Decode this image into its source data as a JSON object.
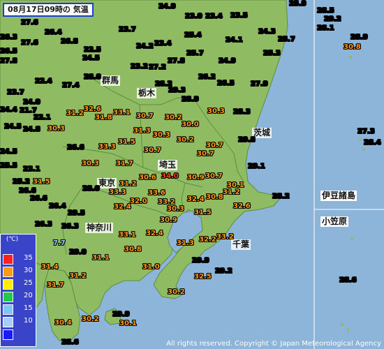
{
  "title": "08月17日09時の 気温",
  "copyright": "All rights reserved. Copyright © Japan Meteorological Agency",
  "colors": {
    "sea": "#8db4d9",
    "land": "#8fbb63",
    "border": "#5d8d3f",
    "legend_bg": "#3a44c8"
  },
  "legend": {
    "unit": "(℃)",
    "items": [
      {
        "value": "35",
        "color": "#ff2020"
      },
      {
        "value": "30",
        "color": "#ff9a16"
      },
      {
        "value": "25",
        "color": "#ffee00"
      },
      {
        "value": "20",
        "color": "#22c94a"
      },
      {
        "value": "15",
        "color": "#7fc4f4"
      },
      {
        "value": "10",
        "color": "#aacbff"
      },
      {
        "value": "",
        "color": "#1a1aff"
      }
    ]
  },
  "places": [
    {
      "name": "群馬",
      "id": "gunma"
    },
    {
      "name": "栃木",
      "id": "tochigi"
    },
    {
      "name": "茨城",
      "id": "ibaraki"
    },
    {
      "name": "埼玉",
      "id": "saitama"
    },
    {
      "name": "東京",
      "id": "tokyo"
    },
    {
      "name": "神奈川",
      "id": "kanagawa"
    },
    {
      "name": "千葉",
      "id": "chiba"
    },
    {
      "name": "伊豆諸島",
      "id": "izu"
    },
    {
      "name": "小笠原",
      "id": "ogasawara"
    }
  ],
  "stations": [
    {
      "v": "24.9",
      "c": "green"
    },
    {
      "v": "25.9",
      "c": "green"
    },
    {
      "v": "23.0",
      "c": "green"
    },
    {
      "v": "23.4",
      "c": "green"
    },
    {
      "v": "23.5",
      "c": "green"
    },
    {
      "v": "26.3",
      "c": "green"
    },
    {
      "v": "27.6",
      "c": "green"
    },
    {
      "v": "26.4",
      "c": "green"
    },
    {
      "v": "28.5",
      "c": "green"
    },
    {
      "v": "29.2",
      "c": "green"
    },
    {
      "v": "28.1",
      "c": "green"
    },
    {
      "v": "23.7",
      "c": "green"
    },
    {
      "v": "24.3",
      "c": "green"
    },
    {
      "v": "25.7",
      "c": "green"
    },
    {
      "v": "27.6",
      "c": "green"
    },
    {
      "v": "26.8",
      "c": "green"
    },
    {
      "v": "25.4",
      "c": "green"
    },
    {
      "v": "24.1",
      "c": "green"
    },
    {
      "v": "28.9",
      "c": "green"
    },
    {
      "v": "24.2",
      "c": "green"
    },
    {
      "v": "23.4",
      "c": "green"
    },
    {
      "v": "30.8",
      "c": "orange"
    },
    {
      "v": "26.5",
      "c": "green"
    },
    {
      "v": "22.5",
      "c": "green"
    },
    {
      "v": "25.7",
      "c": "green"
    },
    {
      "v": "25.3",
      "c": "green"
    },
    {
      "v": "27.8",
      "c": "green"
    },
    {
      "v": "24.5",
      "c": "green"
    },
    {
      "v": "27.8",
      "c": "green"
    },
    {
      "v": "24.9",
      "c": "green"
    },
    {
      "v": "23.2",
      "c": "green"
    },
    {
      "v": "27.2",
      "c": "green"
    },
    {
      "v": "28.0",
      "c": "green"
    },
    {
      "v": "26.2",
      "c": "green"
    },
    {
      "v": "22.4",
      "c": "green"
    },
    {
      "v": "27.4",
      "c": "green"
    },
    {
      "v": "28.2",
      "c": "green"
    },
    {
      "v": "26.5",
      "c": "green"
    },
    {
      "v": "27.9",
      "c": "green"
    },
    {
      "v": "23.7",
      "c": "green"
    },
    {
      "v": "29.3",
      "c": "green"
    },
    {
      "v": "24.0",
      "c": "green"
    },
    {
      "v": "28.9",
      "c": "green"
    },
    {
      "v": "24.4",
      "c": "green"
    },
    {
      "v": "21.7",
      "c": "green"
    },
    {
      "v": "32.6",
      "c": "orange"
    },
    {
      "v": "33.1",
      "c": "orange"
    },
    {
      "v": "30.3",
      "c": "orange"
    },
    {
      "v": "28.3",
      "c": "green"
    },
    {
      "v": "22.1",
      "c": "green"
    },
    {
      "v": "31.2",
      "c": "orange"
    },
    {
      "v": "31.8",
      "c": "orange"
    },
    {
      "v": "30.7",
      "c": "orange"
    },
    {
      "v": "30.2",
      "c": "orange"
    },
    {
      "v": "24.5",
      "c": "green"
    },
    {
      "v": "24.8",
      "c": "green"
    },
    {
      "v": "30.3",
      "c": "orange"
    },
    {
      "v": "31.3",
      "c": "orange"
    },
    {
      "v": "30.0",
      "c": "orange"
    },
    {
      "v": "27.3",
      "c": "green"
    },
    {
      "v": "30.3",
      "c": "orange"
    },
    {
      "v": "29.8",
      "c": "green"
    },
    {
      "v": "28.4",
      "c": "green"
    },
    {
      "v": "26.6",
      "c": "green"
    },
    {
      "v": "33.3",
      "c": "orange"
    },
    {
      "v": "31.5",
      "c": "orange"
    },
    {
      "v": "30.2",
      "c": "orange"
    },
    {
      "v": "30.7",
      "c": "orange"
    },
    {
      "v": "24.5",
      "c": "green"
    },
    {
      "v": "30.7",
      "c": "orange"
    },
    {
      "v": "30.7",
      "c": "orange"
    },
    {
      "v": "25.5",
      "c": "green"
    },
    {
      "v": "30.3",
      "c": "orange"
    },
    {
      "v": "31.7",
      "c": "orange"
    },
    {
      "v": "29.1",
      "c": "green"
    },
    {
      "v": "23.1",
      "c": "green"
    },
    {
      "v": "30.6",
      "c": "orange"
    },
    {
      "v": "34.0",
      "c": "red"
    },
    {
      "v": "30.9",
      "c": "orange"
    },
    {
      "v": "30.7",
      "c": "orange"
    },
    {
      "v": "25.2",
      "c": "green"
    },
    {
      "v": "31.5",
      "c": "orange"
    },
    {
      "v": "31.2",
      "c": "orange"
    },
    {
      "v": "30.1",
      "c": "orange"
    },
    {
      "v": "26.6",
      "c": "green"
    },
    {
      "v": "28.0",
      "c": "green"
    },
    {
      "v": "33.3",
      "c": "orange"
    },
    {
      "v": "33.6",
      "c": "orange"
    },
    {
      "v": "31.2",
      "c": "orange"
    },
    {
      "v": "28.2",
      "c": "green"
    },
    {
      "v": "26.6",
      "c": "green"
    },
    {
      "v": "32.0",
      "c": "orange"
    },
    {
      "v": "33.2",
      "c": "orange"
    },
    {
      "v": "32.4",
      "c": "orange"
    },
    {
      "v": "30.8",
      "c": "orange"
    },
    {
      "v": "26.4",
      "c": "green"
    },
    {
      "v": "32.4",
      "c": "orange"
    },
    {
      "v": "30.3",
      "c": "orange"
    },
    {
      "v": "32.6",
      "c": "orange"
    },
    {
      "v": "29.5",
      "c": "green"
    },
    {
      "v": "31.5",
      "c": "orange"
    },
    {
      "v": "30.9",
      "c": "orange"
    },
    {
      "v": "26.3",
      "c": "green"
    },
    {
      "v": "26.3",
      "c": "green"
    },
    {
      "v": "33.1",
      "c": "orange"
    },
    {
      "v": "32.4",
      "c": "orange"
    },
    {
      "v": "32.2",
      "c": "orange"
    },
    {
      "v": "33.2",
      "c": "orange"
    },
    {
      "v": "7.7",
      "c": "cyan"
    },
    {
      "v": "31.3",
      "c": "orange"
    },
    {
      "v": "29.0",
      "c": "green"
    },
    {
      "v": "30.8",
      "c": "orange"
    },
    {
      "v": "31.1",
      "c": "orange"
    },
    {
      "v": "29.9",
      "c": "green"
    },
    {
      "v": "31.4",
      "c": "orange"
    },
    {
      "v": "31.0",
      "c": "orange"
    },
    {
      "v": "29.2",
      "c": "green"
    },
    {
      "v": "32.5",
      "c": "orange"
    },
    {
      "v": "31.2",
      "c": "orange"
    },
    {
      "v": "28.6",
      "c": "green"
    },
    {
      "v": "31.7",
      "c": "orange"
    },
    {
      "v": "30.2",
      "c": "orange"
    },
    {
      "v": "29.9",
      "c": "green"
    },
    {
      "v": "30.2",
      "c": "orange"
    },
    {
      "v": "30.1",
      "c": "orange"
    },
    {
      "v": "30.4",
      "c": "orange"
    },
    {
      "v": "28.6",
      "c": "green"
    }
  ]
}
